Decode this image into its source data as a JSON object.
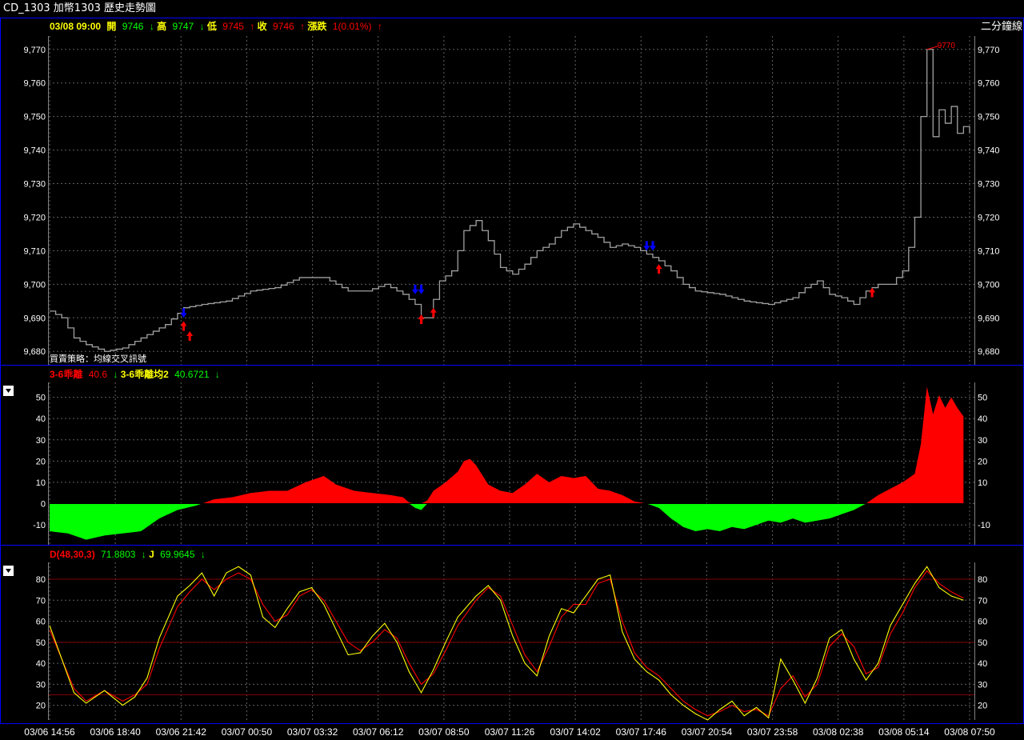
{
  "window": {
    "title": "CD_1303 加幣1303  歷史走勢圖"
  },
  "price_panel": {
    "legend": {
      "datetime": "03/08 09:00",
      "open_label": "開",
      "open": "9746",
      "open_arrow": "↓",
      "high_label": "高",
      "high": "9747",
      "high_arrow": "↓",
      "low_label": "低",
      "low": "9745",
      "low_arrow": "↑",
      "close_label": "收",
      "close": "9746",
      "close_arrow": "↑",
      "change_label": "漲跌",
      "change": "1(0.01%)",
      "change_arrow": "↑"
    },
    "period_label": "二分鐘線",
    "strategy_label": "買賣策略：均線交叉訊號",
    "peak_label": "9770"
  },
  "bias_panel": {
    "legend": {
      "name1": "3-6乖離",
      "value1": "40.6",
      "arrow1": "↓",
      "name2": "3-6乖離均2",
      "value2": "40.6721",
      "arrow2": "↓"
    }
  },
  "kd_panel": {
    "legend": {
      "name1": "D(48,30,3)",
      "value1": "71.8803",
      "arrow1": "↓",
      "name2": "J",
      "value2": "69.9645",
      "arrow2": "↓"
    }
  },
  "x_ticks": [
    "03/06 14:56",
    "03/06 18:40",
    "03/06 21:42",
    "03/07 00:50",
    "03/07 03:32",
    "03/07 06:12",
    "03/07 08:50",
    "03/07 11:26",
    "03/07 14:02",
    "03/07 17:46",
    "03/07 20:54",
    "03/07 23:58",
    "03/08 02:38",
    "03/08 05:14",
    "03/08 07:50"
  ],
  "colors": {
    "border": "#0000ff",
    "grid": "#606060",
    "price_line": "#a0a0a0",
    "up": "#ff0000",
    "down": "#00ff00",
    "yellow": "#ffff00",
    "red_text": "#ff0000",
    "green_text": "#00ff00",
    "buy_signal": "#ff0000",
    "sell_signal": "#0000ff"
  },
  "chart_data": [
    {
      "type": "line",
      "name": "price",
      "ylim": [
        9676,
        9774
      ],
      "yticks": [
        9680,
        9690,
        9700,
        9710,
        9720,
        9730,
        9740,
        9750,
        9760,
        9770
      ],
      "ytick_labels": [
        "9,680",
        "9,690",
        "9,700",
        "9,710",
        "9,720",
        "9,730",
        "9,740",
        "9,750",
        "9,760",
        "9,770"
      ],
      "anchors": [
        [
          0,
          9692
        ],
        [
          2,
          9690
        ],
        [
          4,
          9684
        ],
        [
          6,
          9682
        ],
        [
          9,
          9680
        ],
        [
          12,
          9681
        ],
        [
          16,
          9685
        ],
        [
          19,
          9688
        ],
        [
          22,
          9693
        ],
        [
          25,
          9694
        ],
        [
          29,
          9695
        ],
        [
          33,
          9698
        ],
        [
          37,
          9699
        ],
        [
          41,
          9702
        ],
        [
          45,
          9702
        ],
        [
          49,
          9698
        ],
        [
          52,
          9698
        ],
        [
          55,
          9700
        ],
        [
          58,
          9697
        ],
        [
          60,
          9694
        ],
        [
          61,
          9690
        ],
        [
          62,
          9690
        ],
        [
          64,
          9701
        ],
        [
          66,
          9704
        ],
        [
          68,
          9716
        ],
        [
          70,
          9719
        ],
        [
          72,
          9713
        ],
        [
          74,
          9705
        ],
        [
          76,
          9703
        ],
        [
          78,
          9706
        ],
        [
          80,
          9710
        ],
        [
          82,
          9712
        ],
        [
          84,
          9716
        ],
        [
          86,
          9718
        ],
        [
          88,
          9716
        ],
        [
          90,
          9714
        ],
        [
          92,
          9711
        ],
        [
          94,
          9712
        ],
        [
          96,
          9711
        ],
        [
          98,
          9709
        ],
        [
          100,
          9707
        ],
        [
          102,
          9704
        ],
        [
          104,
          9700
        ],
        [
          106,
          9698
        ],
        [
          110,
          9697
        ],
        [
          114,
          9695
        ],
        [
          118,
          9694
        ],
        [
          122,
          9696
        ],
        [
          124,
          9699
        ],
        [
          126,
          9701
        ],
        [
          128,
          9697
        ],
        [
          130,
          9696
        ],
        [
          132,
          9694
        ],
        [
          134,
          9698
        ],
        [
          136,
          9700
        ],
        [
          138,
          9700
        ],
        [
          140,
          9704
        ],
        [
          141,
          9711
        ],
        [
          142,
          9720
        ],
        [
          143,
          9750
        ],
        [
          144,
          9770
        ],
        [
          145,
          9744
        ],
        [
          146,
          9752
        ],
        [
          147,
          9748
        ],
        [
          148,
          9753
        ],
        [
          149,
          9745
        ],
        [
          150,
          9747
        ],
        [
          151,
          9745
        ]
      ],
      "buy_signals": [
        [
          22,
          9689
        ],
        [
          23,
          9686
        ],
        [
          61,
          9691
        ],
        [
          63,
          9693
        ],
        [
          100,
          9706
        ],
        [
          135,
          9699
        ]
      ],
      "sell_signals": [
        [
          22,
          9690
        ],
        [
          60,
          9697
        ],
        [
          61,
          9697
        ],
        [
          98,
          9710
        ],
        [
          99,
          9710
        ]
      ],
      "peak": [
        144,
        9770
      ]
    },
    {
      "type": "area",
      "name": "3-6乖離",
      "ylim": [
        -19,
        57
      ],
      "yticks": [
        -10,
        0,
        10,
        20,
        30,
        40,
        50
      ],
      "anchors": [
        [
          0,
          -13
        ],
        [
          3,
          -14
        ],
        [
          6,
          -17
        ],
        [
          9,
          -15
        ],
        [
          12,
          -14
        ],
        [
          15,
          -13
        ],
        [
          18,
          -7
        ],
        [
          21,
          -3
        ],
        [
          24,
          -1
        ],
        [
          27,
          2
        ],
        [
          30,
          3
        ],
        [
          33,
          5
        ],
        [
          36,
          6
        ],
        [
          39,
          6
        ],
        [
          42,
          10
        ],
        [
          45,
          13
        ],
        [
          47,
          9
        ],
        [
          50,
          6
        ],
        [
          53,
          5
        ],
        [
          56,
          4
        ],
        [
          58,
          3
        ],
        [
          60,
          -2
        ],
        [
          61,
          -3
        ],
        [
          63,
          6
        ],
        [
          65,
          10
        ],
        [
          67,
          15
        ],
        [
          68,
          20
        ],
        [
          69,
          21
        ],
        [
          70,
          18
        ],
        [
          72,
          9
        ],
        [
          74,
          6
        ],
        [
          76,
          5
        ],
        [
          78,
          9
        ],
        [
          80,
          14
        ],
        [
          82,
          10
        ],
        [
          84,
          13
        ],
        [
          86,
          12
        ],
        [
          88,
          13
        ],
        [
          90,
          7
        ],
        [
          92,
          6
        ],
        [
          94,
          4
        ],
        [
          96,
          1
        ],
        [
          98,
          0
        ],
        [
          100,
          -2
        ],
        [
          102,
          -7
        ],
        [
          104,
          -11
        ],
        [
          106,
          -13
        ],
        [
          108,
          -12
        ],
        [
          110,
          -13
        ],
        [
          112,
          -11
        ],
        [
          114,
          -12
        ],
        [
          116,
          -10
        ],
        [
          118,
          -8
        ],
        [
          120,
          -9
        ],
        [
          122,
          -7
        ],
        [
          124,
          -9
        ],
        [
          126,
          -8
        ],
        [
          128,
          -7
        ],
        [
          130,
          -5
        ],
        [
          132,
          -3
        ],
        [
          134,
          0
        ],
        [
          136,
          4
        ],
        [
          138,
          7
        ],
        [
          140,
          10
        ],
        [
          142,
          14
        ],
        [
          143,
          28
        ],
        [
          144,
          55
        ],
        [
          145,
          42
        ],
        [
          146,
          51
        ],
        [
          147,
          45
        ],
        [
          148,
          50
        ],
        [
          149,
          45
        ],
        [
          150,
          41
        ]
      ]
    },
    {
      "type": "line",
      "name": "D(48,30,3)",
      "ylim": [
        13,
        88
      ],
      "yticks": [
        20,
        30,
        40,
        50,
        60,
        70,
        80
      ],
      "ref_lines": [
        80,
        50,
        25
      ],
      "anchors": [
        [
          0,
          56
        ],
        [
          2,
          42
        ],
        [
          4,
          28
        ],
        [
          6,
          22
        ],
        [
          9,
          27
        ],
        [
          12,
          22
        ],
        [
          14,
          25
        ],
        [
          16,
          30
        ],
        [
          18,
          47
        ],
        [
          21,
          67
        ],
        [
          23,
          74
        ],
        [
          25,
          80
        ],
        [
          27,
          75
        ],
        [
          29,
          80
        ],
        [
          31,
          83
        ],
        [
          33,
          80
        ],
        [
          35,
          68
        ],
        [
          37,
          60
        ],
        [
          39,
          63
        ],
        [
          41,
          72
        ],
        [
          43,
          75
        ],
        [
          45,
          70
        ],
        [
          47,
          60
        ],
        [
          49,
          50
        ],
        [
          51,
          46
        ],
        [
          53,
          50
        ],
        [
          55,
          56
        ],
        [
          57,
          52
        ],
        [
          59,
          40
        ],
        [
          61,
          30
        ],
        [
          63,
          35
        ],
        [
          65,
          46
        ],
        [
          67,
          58
        ],
        [
          70,
          70
        ],
        [
          72,
          76
        ],
        [
          74,
          72
        ],
        [
          76,
          58
        ],
        [
          78,
          44
        ],
        [
          80,
          36
        ],
        [
          82,
          48
        ],
        [
          84,
          62
        ],
        [
          86,
          68
        ],
        [
          88,
          68
        ],
        [
          90,
          78
        ],
        [
          92,
          80
        ],
        [
          94,
          60
        ],
        [
          96,
          45
        ],
        [
          98,
          38
        ],
        [
          100,
          34
        ],
        [
          102,
          28
        ],
        [
          104,
          22
        ],
        [
          106,
          18
        ],
        [
          108,
          15
        ],
        [
          110,
          17
        ],
        [
          112,
          20
        ],
        [
          114,
          17
        ],
        [
          116,
          18
        ],
        [
          118,
          15
        ],
        [
          120,
          28
        ],
        [
          122,
          34
        ],
        [
          124,
          24
        ],
        [
          126,
          30
        ],
        [
          128,
          48
        ],
        [
          130,
          54
        ],
        [
          132,
          48
        ],
        [
          134,
          35
        ],
        [
          136,
          38
        ],
        [
          138,
          54
        ],
        [
          140,
          64
        ],
        [
          142,
          76
        ],
        [
          144,
          84
        ],
        [
          146,
          78
        ],
        [
          148,
          74
        ],
        [
          150,
          71
        ]
      ]
    },
    {
      "type": "line",
      "name": "J",
      "anchors": [
        [
          0,
          58
        ],
        [
          2,
          42
        ],
        [
          4,
          26
        ],
        [
          6,
          21
        ],
        [
          9,
          27
        ],
        [
          12,
          20
        ],
        [
          14,
          24
        ],
        [
          16,
          33
        ],
        [
          18,
          52
        ],
        [
          21,
          72
        ],
        [
          23,
          77
        ],
        [
          25,
          83
        ],
        [
          27,
          72
        ],
        [
          29,
          83
        ],
        [
          31,
          86
        ],
        [
          33,
          82
        ],
        [
          35,
          62
        ],
        [
          37,
          57
        ],
        [
          39,
          66
        ],
        [
          41,
          74
        ],
        [
          43,
          76
        ],
        [
          45,
          68
        ],
        [
          47,
          56
        ],
        [
          49,
          44
        ],
        [
          51,
          45
        ],
        [
          53,
          53
        ],
        [
          55,
          59
        ],
        [
          57,
          50
        ],
        [
          59,
          36
        ],
        [
          61,
          26
        ],
        [
          63,
          37
        ],
        [
          65,
          50
        ],
        [
          67,
          62
        ],
        [
          70,
          72
        ],
        [
          72,
          77
        ],
        [
          74,
          70
        ],
        [
          76,
          53
        ],
        [
          78,
          40
        ],
        [
          80,
          34
        ],
        [
          82,
          53
        ],
        [
          84,
          66
        ],
        [
          86,
          64
        ],
        [
          88,
          72
        ],
        [
          90,
          80
        ],
        [
          92,
          82
        ],
        [
          94,
          55
        ],
        [
          96,
          42
        ],
        [
          98,
          36
        ],
        [
          100,
          32
        ],
        [
          102,
          25
        ],
        [
          104,
          20
        ],
        [
          106,
          16
        ],
        [
          108,
          13
        ],
        [
          110,
          18
        ],
        [
          112,
          22
        ],
        [
          114,
          15
        ],
        [
          116,
          19
        ],
        [
          118,
          14
        ],
        [
          120,
          42
        ],
        [
          122,
          32
        ],
        [
          124,
          21
        ],
        [
          126,
          33
        ],
        [
          128,
          52
        ],
        [
          130,
          56
        ],
        [
          132,
          42
        ],
        [
          134,
          32
        ],
        [
          136,
          40
        ],
        [
          138,
          58
        ],
        [
          140,
          68
        ],
        [
          142,
          78
        ],
        [
          144,
          86
        ],
        [
          146,
          76
        ],
        [
          148,
          72
        ],
        [
          150,
          70
        ]
      ]
    }
  ]
}
